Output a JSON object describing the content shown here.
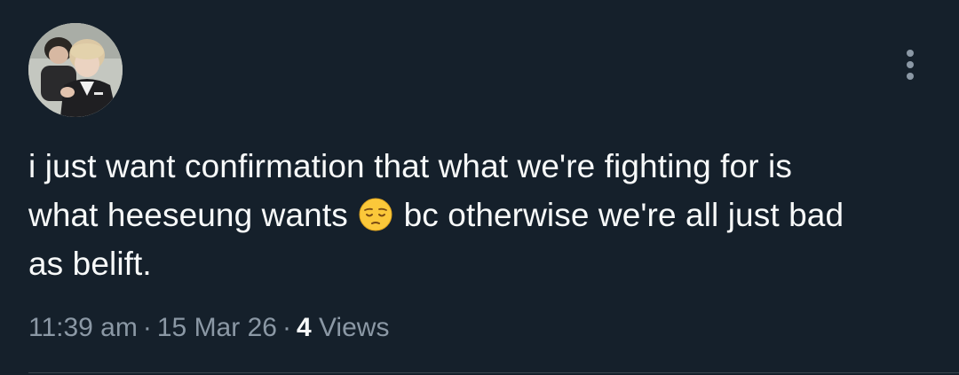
{
  "tweet": {
    "text_line1": "i just want confirmation that what we're fighting for is",
    "text_line2_before_emoji": "what heeseung wants",
    "emoji": "pensive-face-emoji",
    "text_line2_after_emoji": "bc otherwise we're all just bad",
    "text_line3": "as belift.",
    "time": "11:39 am",
    "date": "15 Mar 26",
    "separator": "·",
    "views_count": "4",
    "views_label": "Views"
  },
  "icons": {
    "more": "more-vertical-icon"
  },
  "colors": {
    "background": "#15202b",
    "text": "#f7f9f9",
    "secondary_text": "#8b98a5",
    "divider": "#38444d"
  }
}
